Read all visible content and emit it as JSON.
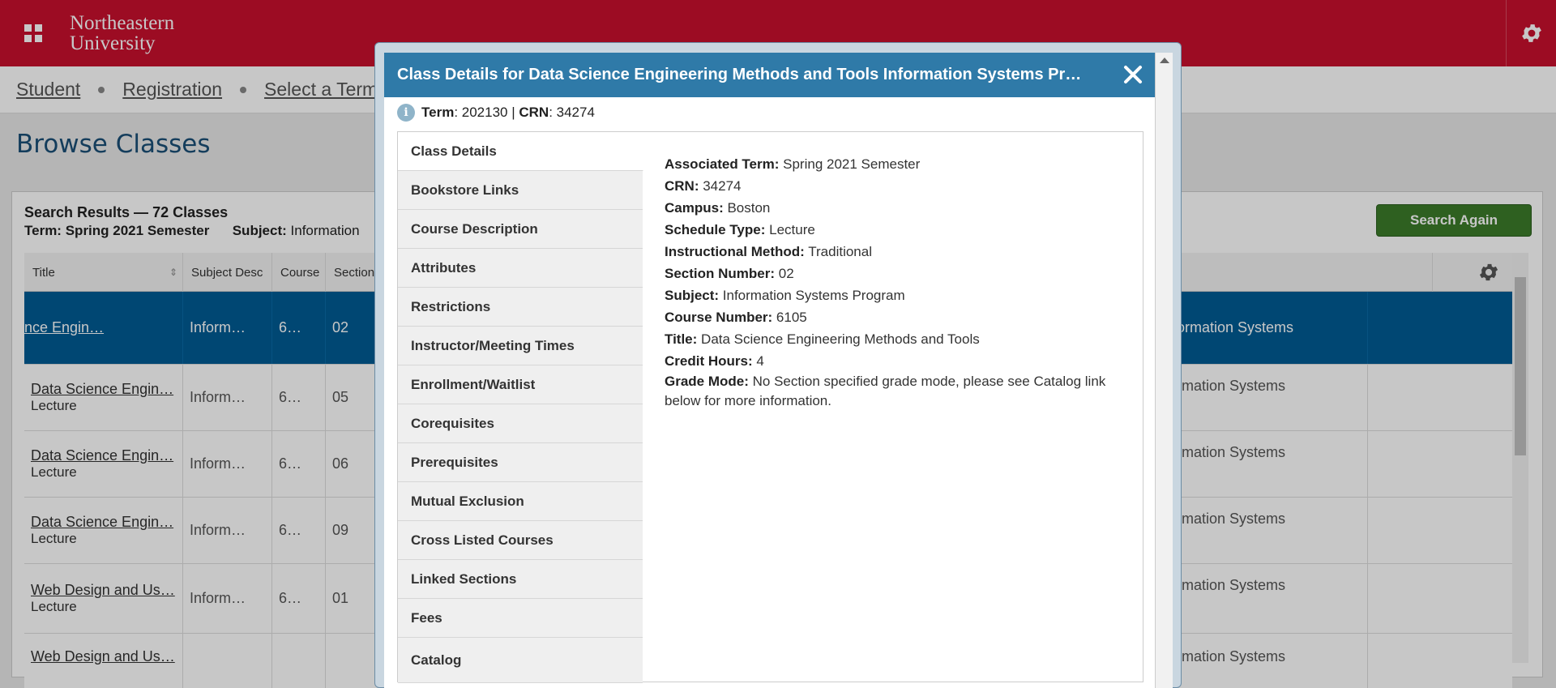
{
  "brand": {
    "logo_line1": "Northeastern",
    "logo_line2": "University"
  },
  "breadcrumb": {
    "items": [
      "Student",
      "Registration",
      "Select a Term"
    ]
  },
  "page_title": "Browse Classes",
  "search_results": {
    "title": "Search Results — 72 Classes",
    "term_label": "Term:",
    "term_value": "Spring 2021 Semester",
    "subject_label": "Subject:",
    "subject_value": "Information",
    "search_again": "Search Again"
  },
  "table": {
    "headers": [
      "Title",
      "Subject Desc",
      "Course",
      "Section"
    ],
    "rows": [
      {
        "title": "nce Engin…",
        "sub": "",
        "subject": "Inform…",
        "course": "6…",
        "section": "02",
        "right": "ormation Systems",
        "selected": true
      },
      {
        "title": "Data Science Engin…",
        "sub": "Lecture",
        "subject": "Inform…",
        "course": "6…",
        "section": "05",
        "right": "rmation Systems"
      },
      {
        "title": "Data Science Engin…",
        "sub": "Lecture",
        "subject": "Inform…",
        "course": "6…",
        "section": "06",
        "right": "rmation Systems"
      },
      {
        "title": "Data Science Engin…",
        "sub": "Lecture",
        "subject": "Inform…",
        "course": "6…",
        "section": "09",
        "right": "rmation Systems"
      },
      {
        "title": "Web Design and Us…",
        "sub": "Lecture",
        "subject": "Inform…",
        "course": "6…",
        "section": "01",
        "right": "rmation Systems"
      },
      {
        "title": "Web Design and Us…",
        "sub": "",
        "subject": "",
        "course": "",
        "section": "",
        "right": "rmation Systems"
      }
    ]
  },
  "modal": {
    "title": "Class Details for Data Science Engineering Methods and Tools Information Systems Pr…",
    "term_label": "Term",
    "term_value": ": 202130 | ",
    "crn_label": "CRN",
    "crn_value": ": 34274",
    "tabs": [
      "Class Details",
      "Bookstore Links",
      "Course Description",
      "Attributes",
      "Restrictions",
      "Instructor/Meeting Times",
      "Enrollment/Waitlist",
      "Corequisites",
      "Prerequisites",
      "Mutual Exclusion",
      "Cross Listed Courses",
      "Linked Sections",
      "Fees",
      "Catalog"
    ],
    "details": [
      {
        "label": "Associated Term:",
        "value": " Spring 2021 Semester"
      },
      {
        "label": "CRN:",
        "value": " 34274"
      },
      {
        "label": "Campus:",
        "value": " Boston"
      },
      {
        "label": "Schedule Type:",
        "value": " Lecture"
      },
      {
        "label": "Instructional Method:",
        "value": " Traditional"
      },
      {
        "label": "Section Number:",
        "value": " 02"
      },
      {
        "label": "Subject:",
        "value": " Information Systems Program"
      },
      {
        "label": "Course Number:",
        "value": " 6105"
      },
      {
        "label": "Title:",
        "value": " Data Science Engineering Methods and Tools"
      },
      {
        "label": "Credit Hours:",
        "value": " 4"
      },
      {
        "label": "Grade Mode:",
        "value": " No Section specified grade mode, please see Catalog link below for more information."
      }
    ]
  },
  "colors": {
    "brand": "#c8102e",
    "accent": "#2f7aa8",
    "selected_row": "#005b94",
    "button": "#3b7b2a"
  },
  "icons": {
    "apps": "apps-grid-icon",
    "gear": "gear-icon",
    "close": "close-icon",
    "info": "info-icon"
  }
}
